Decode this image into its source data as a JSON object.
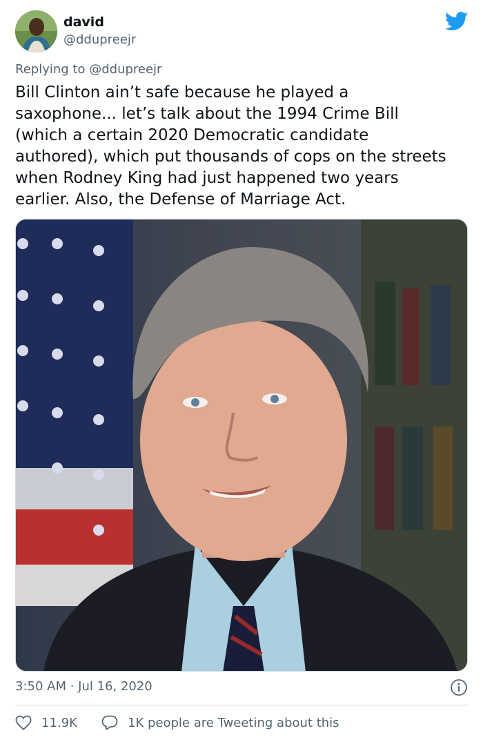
{
  "author": {
    "display_name": "david",
    "handle": "@ddupreejr"
  },
  "reply": {
    "prefix": "Replying to",
    "handle": "@ddupreejr"
  },
  "tweet": {
    "text": "Bill Clinton ain’t safe because he played a\nsaxophone... let’s talk about the 1994 Crime Bill\n(which a certain 2020 Democratic candidate\nauthored), which put thousands of cops on the streets\nwhen Rodney King had just happened two years\nearlier. Also, the Defense of Marriage Act.",
    "timestamp": "3:50 AM · Jul 16, 2020"
  },
  "stats": {
    "likes": "11.9K",
    "tweeting_label": "1K people are Tweeting about this"
  },
  "icons": {
    "brand": "twitter-bird-icon",
    "info": "info-icon",
    "like": "heart-icon",
    "reply": "speech-bubble-icon"
  },
  "colors": {
    "twitter_blue": "#1d9bf0",
    "secondary_text": "#536471",
    "primary_text": "#0f1419",
    "divider": "#cfd9de"
  }
}
